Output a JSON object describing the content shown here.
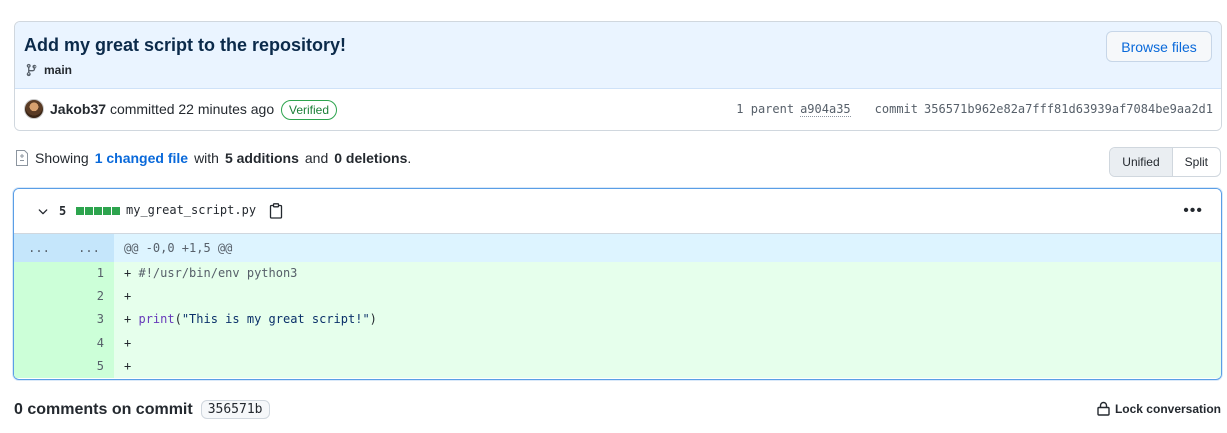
{
  "commit": {
    "title": "Add my great script to the repository!",
    "branch": "main",
    "browse_files_label": "Browse files",
    "author": "Jakob37",
    "action_text": "committed 22 minutes ago",
    "verified_label": "Verified",
    "parent_label": "1 parent",
    "parent_sha": "a904a35",
    "commit_label": "commit",
    "commit_sha": "356571b962e82a7fff81d63939af7084be9aa2d1"
  },
  "stats": {
    "showing": "Showing",
    "changed_files": "1 changed file",
    "with": "with",
    "additions": "5 additions",
    "and": "and",
    "deletions": "0 deletions",
    "period": "."
  },
  "view_toggle": {
    "unified": "Unified",
    "split": "Split",
    "selected": "Unified"
  },
  "diff": {
    "additions_count": "5",
    "filename": "my_great_script.py",
    "hunk_old_marker": "...",
    "hunk_new_marker": "...",
    "hunk_header": "@@ -0,0 +1,5 @@",
    "lines": [
      {
        "num": "1",
        "plus": "+",
        "text": "#!/usr/bin/env python3"
      },
      {
        "num": "2",
        "plus": "+",
        "text": ""
      },
      {
        "num": "3",
        "plus": "+",
        "fn": "print",
        "str": "\"This is my great script!\""
      },
      {
        "num": "4",
        "plus": "+",
        "text": ""
      },
      {
        "num": "5",
        "plus": "+",
        "text": ""
      }
    ]
  },
  "comments": {
    "title": "0 comments on commit",
    "sha": "356571b",
    "lock_label": "Lock conversation"
  },
  "icons": [
    "branch-icon",
    "file-diff-icon",
    "chevron-down-icon",
    "copy-icon",
    "kebab-icon",
    "lock-icon"
  ],
  "colors": {
    "accent": "#0969da",
    "addition_bg": "#e6ffec",
    "addition_gutter": "#ccffd8",
    "addition_block": "#2da44e"
  }
}
